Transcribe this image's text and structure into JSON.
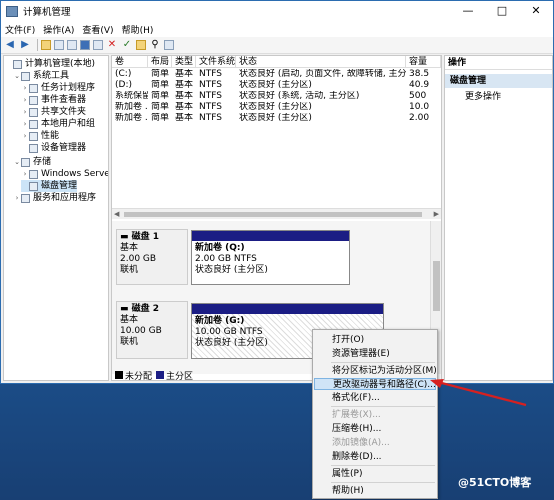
{
  "window": {
    "title": "计算机管理"
  },
  "menu": [
    "文件(F)",
    "操作(A)",
    "查看(V)",
    "帮助(H)"
  ],
  "toolbar_icons": [
    "back-arrow-icon",
    "forward-arrow-icon",
    "up-folder-icon",
    "folder-icon",
    "properties-icon",
    "help-icon",
    "connect-icon",
    "delete-icon",
    "check-icon",
    "open-folder-icon",
    "search-icon",
    "refresh-icon"
  ],
  "tree": [
    {
      "label": "计算机管理(本地)",
      "level": 0,
      "arrow": "",
      "icon": "computer-icon"
    },
    {
      "label": "系统工具",
      "level": 1,
      "arrow": "⌄",
      "icon": "tools-icon"
    },
    {
      "label": "任务计划程序",
      "level": 2,
      "arrow": "›",
      "icon": "clock-icon"
    },
    {
      "label": "事件查看器",
      "level": 2,
      "arrow": "›",
      "icon": "event-log-icon"
    },
    {
      "label": "共享文件夹",
      "level": 2,
      "arrow": "›",
      "icon": "shared-folder-icon"
    },
    {
      "label": "本地用户和组",
      "level": 2,
      "arrow": "›",
      "icon": "users-icon"
    },
    {
      "label": "性能",
      "level": 2,
      "arrow": "›",
      "icon": "performance-icon"
    },
    {
      "label": "设备管理器",
      "level": 2,
      "arrow": "",
      "icon": "device-manager-icon"
    },
    {
      "label": "存储",
      "level": 1,
      "arrow": "⌄",
      "icon": "storage-icon"
    },
    {
      "label": "Windows Server B",
      "level": 2,
      "arrow": "›",
      "icon": "backup-icon"
    },
    {
      "label": "磁盘管理",
      "level": 2,
      "arrow": "",
      "icon": "disk-management-icon",
      "selected": true
    },
    {
      "label": "服务和应用程序",
      "level": 1,
      "arrow": "›",
      "icon": "services-icon"
    }
  ],
  "volumes": {
    "columns": [
      "卷",
      "布局",
      "类型",
      "文件系统",
      "状态",
      "容量"
    ],
    "rows": [
      [
        "(C:)",
        "简单",
        "基本",
        "NTFS",
        "状态良好 (启动, 页面文件, 故障转储, 主分区)",
        "38.5"
      ],
      [
        "(D:)",
        "简单",
        "基本",
        "NTFS",
        "状态良好 (主分区)",
        "40.9"
      ],
      [
        "系统保留",
        "简单",
        "基本",
        "NTFS",
        "状态良好 (系统, 活动, 主分区)",
        "500"
      ],
      [
        "新加卷 ...",
        "简单",
        "基本",
        "NTFS",
        "状态良好 (主分区)",
        "10.0"
      ],
      [
        "新加卷 ...",
        "简单",
        "基本",
        "NTFS",
        "状态良好 (主分区)",
        "2.00"
      ]
    ]
  },
  "disks": [
    {
      "name": "磁盘 1",
      "type": "基本",
      "size": "2.00 GB",
      "status": "联机",
      "partition": {
        "name": "新加卷 (Q:)",
        "size": "2.00 GB NTFS",
        "state": "状态良好 (主分区)"
      }
    },
    {
      "name": "磁盘 2",
      "type": "基本",
      "size": "10.00 GB",
      "status": "联机",
      "partition": {
        "name": "新加卷 (G:)",
        "size": "10.00 GB NTFS",
        "state": "状态良好 (主分区)"
      }
    }
  ],
  "legend": [
    {
      "label": "未分配",
      "color": "#000000"
    },
    {
      "label": "主分区",
      "color": "#1b1d84"
    }
  ],
  "actions": {
    "header": "操作",
    "section": "磁盘管理",
    "more": "更多操作"
  },
  "context_menu": [
    {
      "label": "打开(O)",
      "disabled": false
    },
    {
      "label": "资源管理器(E)",
      "disabled": false
    },
    {
      "label": "将分区标记为活动分区(M)",
      "disabled": false
    },
    {
      "label": "更改驱动器号和路径(C)...",
      "disabled": false,
      "highlighted": true
    },
    {
      "label": "格式化(F)...",
      "disabled": false
    },
    {
      "label": "扩展卷(X)...",
      "disabled": true
    },
    {
      "label": "压缩卷(H)...",
      "disabled": false
    },
    {
      "label": "添加镜像(A)...",
      "disabled": true
    },
    {
      "label": "删除卷(D)...",
      "disabled": false
    },
    {
      "label": "属性(P)",
      "disabled": false
    },
    {
      "label": "帮助(H)",
      "disabled": false
    }
  ],
  "watermark": "@51CTO博客",
  "colors": {
    "primary_partition": "#1b1d84",
    "highlight": "#cfe4f7",
    "arrow": "#d62020"
  }
}
